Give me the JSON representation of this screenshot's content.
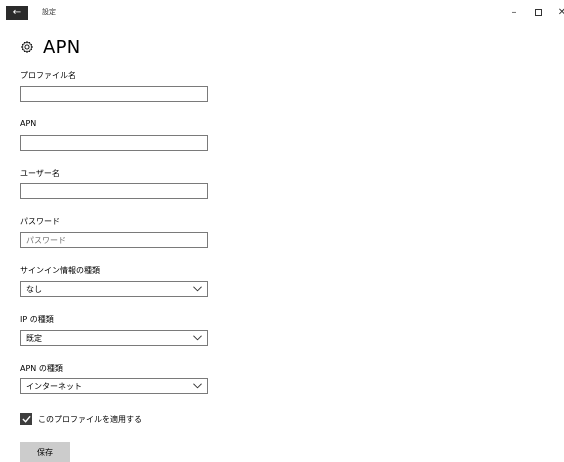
{
  "window": {
    "app_title": "設定",
    "back_glyph": "←",
    "minimize_glyph": "–",
    "close_glyph": "✕"
  },
  "page": {
    "title": "APN"
  },
  "fields": {
    "profile_name": {
      "label": "プロファイル名",
      "value": ""
    },
    "apn": {
      "label": "APN",
      "value": ""
    },
    "user_name": {
      "label": "ユーザー名",
      "value": ""
    },
    "password": {
      "label": "パスワード",
      "placeholder": "パスワード"
    },
    "sign_in_type": {
      "label": "サインイン情報の種類",
      "selected": "なし"
    },
    "ip_type": {
      "label": "IP の種類",
      "selected": "既定"
    },
    "apn_type": {
      "label": "APN の種類",
      "selected": "インターネット"
    }
  },
  "apply_profile": {
    "label": "このプロファイルを適用する",
    "checked": true
  },
  "actions": {
    "save_label": "保存"
  },
  "colors": {
    "accent_dark": "#2b2b2b",
    "field_border": "#7a7a7a",
    "checkbox_fill": "#3d3d3d",
    "button_bg": "#cccccc"
  },
  "icons": {
    "back": "arrow-left-icon",
    "settings": "gear-icon",
    "dropdown": "chevron-down-icon",
    "check": "checkmark-icon"
  }
}
